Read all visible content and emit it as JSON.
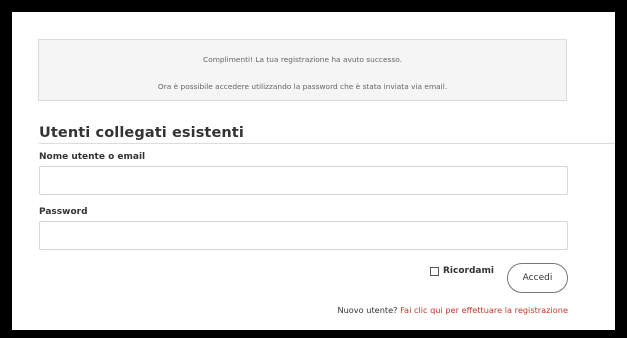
{
  "notice": {
    "line1": "Complimenti! La tua registrazione ha avuto successo.",
    "line2": "Ora è possibile accedere utilizzando la password che è stata inviata via email."
  },
  "login": {
    "title": "Utenti collegati esistenti",
    "username_label": "Nome utente o email",
    "username_value": "",
    "password_label": "Password",
    "password_value": "",
    "remember_label": "Ricordami",
    "remember_checked": false,
    "submit_label": "Accedi"
  },
  "register": {
    "prompt": "Nuovo utente?",
    "link_text": "Fai clic qui per effettuare la registrazione"
  },
  "colors": {
    "link": "#c0392b",
    "frame": "#000000",
    "notice_bg": "#f5f5f5"
  }
}
